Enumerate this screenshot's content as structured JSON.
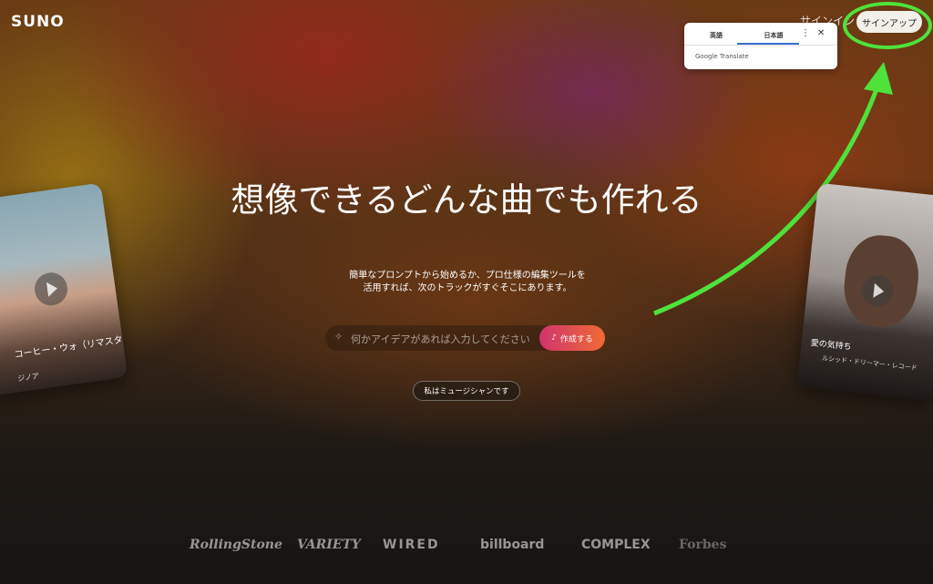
{
  "header": {
    "logo": "SUNO",
    "signin_label": "サインイン",
    "signup_label": "サインアップ"
  },
  "translate_popup": {
    "tab_english": "英語",
    "tab_japanese": "日本語",
    "more_icon": "more-vert-icon",
    "close_icon": "close-icon",
    "branding": "Google Translate"
  },
  "hero": {
    "title": "想像できるどんな曲でも作れる",
    "subtitle": "簡単なプロンプトから始めるか、プロ仕様の編集ツールを活用すれば、次のトラックがすぐそこにあります。"
  },
  "prompt": {
    "placeholder": "何かアイデアがあれば入力してください",
    "create_label": "作成する"
  },
  "musician_label": "私はミュージシャンです",
  "cards": {
    "left": {
      "title": "コーヒー・ウォ（リマスター版）",
      "artist": "ジノア"
    },
    "right": {
      "title": "愛の気持ち",
      "artist": "ルシッド・ドリーマー・レコード"
    }
  },
  "press_logos": [
    "RollingStone",
    "VARIETY",
    "WIRED",
    "billboard",
    "COMPLEX",
    "Forbes"
  ],
  "colors": {
    "annotation_green": "#4ee23b",
    "create_button_start": "#d0346d",
    "create_button_end": "#f06a34"
  }
}
